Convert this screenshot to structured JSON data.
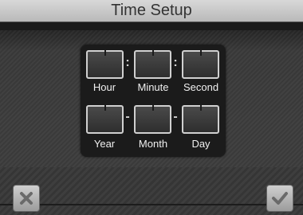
{
  "title": "Time Setup",
  "fields_row1": [
    {
      "label": "Hour",
      "value": ""
    },
    {
      "label": "Minute",
      "value": ""
    },
    {
      "label": "Second",
      "value": ""
    }
  ],
  "separators_row1": [
    ":",
    ":"
  ],
  "fields_row2": [
    {
      "label": "Year",
      "value": ""
    },
    {
      "label": "Month",
      "value": ""
    },
    {
      "label": "Day",
      "value": ""
    }
  ],
  "separators_row2": [
    "-",
    "-"
  ],
  "buttons": {
    "cancel_icon": "close-icon",
    "confirm_icon": "check-icon"
  },
  "colors": {
    "title_bg": "#c8c8c8",
    "panel_bg": "#1b1b1b",
    "box_border": "#d0d0d0"
  }
}
